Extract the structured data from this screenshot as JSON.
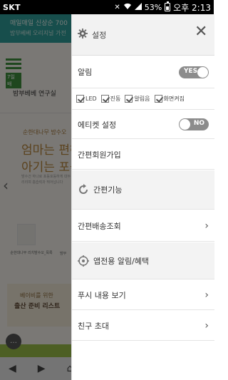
{
  "status_bar": {
    "carrier": "SKT",
    "battery": "53%",
    "time": "오후 2:13"
  },
  "background_page": {
    "banner_line1": "매일매일 신상순 700",
    "banner_line2": "밤부베베 오리지널 가전",
    "menu_tag": "7일 배",
    "page_title": "밤부베베 연구실",
    "sub_label": "순한대나무 밤수오",
    "headline1": "엄마는 편해",
    "headline2": "아기는 포근",
    "paragraph": "밤수건 하나로 포동포동하게 대두리리며 흡습력과 뛰어납니다",
    "product1_label": "순한대나무 리치밤수오_목록",
    "product2_label": "밤부",
    "card_line1": "베이비를 위한",
    "card_line2": "출산 준비 리스트"
  },
  "drawer": {
    "header_title": "설정",
    "close_icon": "close-icon",
    "alarm_label": "알림",
    "alarm_toggle": "YES",
    "checkboxes": [
      "LED",
      "진동",
      "알림음",
      "화면켜짐"
    ],
    "etiquette_label": "에티켓 설정",
    "etiquette_toggle": "NO",
    "simple_signup_label": "간편회원가입",
    "simple_function_label": "간편기능",
    "delivery_lookup_label": "간편배송조회",
    "app_alarm_label": "앱전용 알림/혜택",
    "push_view_label": "푸시 내용 보기",
    "invite_label": "친구 초대"
  }
}
